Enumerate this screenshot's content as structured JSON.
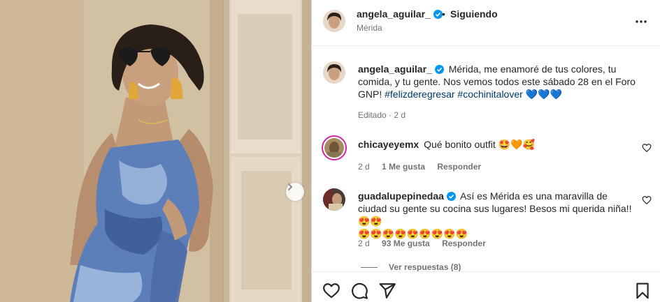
{
  "post": {
    "author": "angela_aguilar_",
    "follow_status": "Siguiendo",
    "dot": "•",
    "location": "Mérida",
    "caption_text": "Mérida, me enamoré de tus colores, tu comida, y tu gente. Nos vemos todos este sábado 28 en el Foro GNP!",
    "hashtag1": "#felizderegresar",
    "hashtag2": "#cochinitalover",
    "caption_emojis": "💙💙💙",
    "edited": "Editado",
    "dot_sep": "·",
    "time": "2 d"
  },
  "comments": [
    {
      "user": "chicayeyemx",
      "text": "Qué bonito outfit 🤩🧡🥰",
      "time": "2 d",
      "likes": "1 Me gusta",
      "reply": "Responder"
    },
    {
      "user": "guadalupepinedaa",
      "text": "Así es Mérida es una maravilla de ciudad su gente su cocina sus lugares! Besos mi querida niña!!😍😍",
      "text2": "😍😍😍😍😍😍😍😍😍",
      "time": "2 d",
      "likes": "93 Me gusta",
      "reply": "Responder",
      "view_replies": "Ver respuestas (8)"
    }
  ],
  "colors": {
    "verified": "#0095f6",
    "link": "#00376b",
    "muted": "#737373",
    "text": "#262626"
  },
  "icons": [
    "verified-badge-icon",
    "more-options-icon",
    "heart-icon",
    "comment-icon",
    "share-icon",
    "bookmark-icon",
    "chevron-right-icon"
  ]
}
